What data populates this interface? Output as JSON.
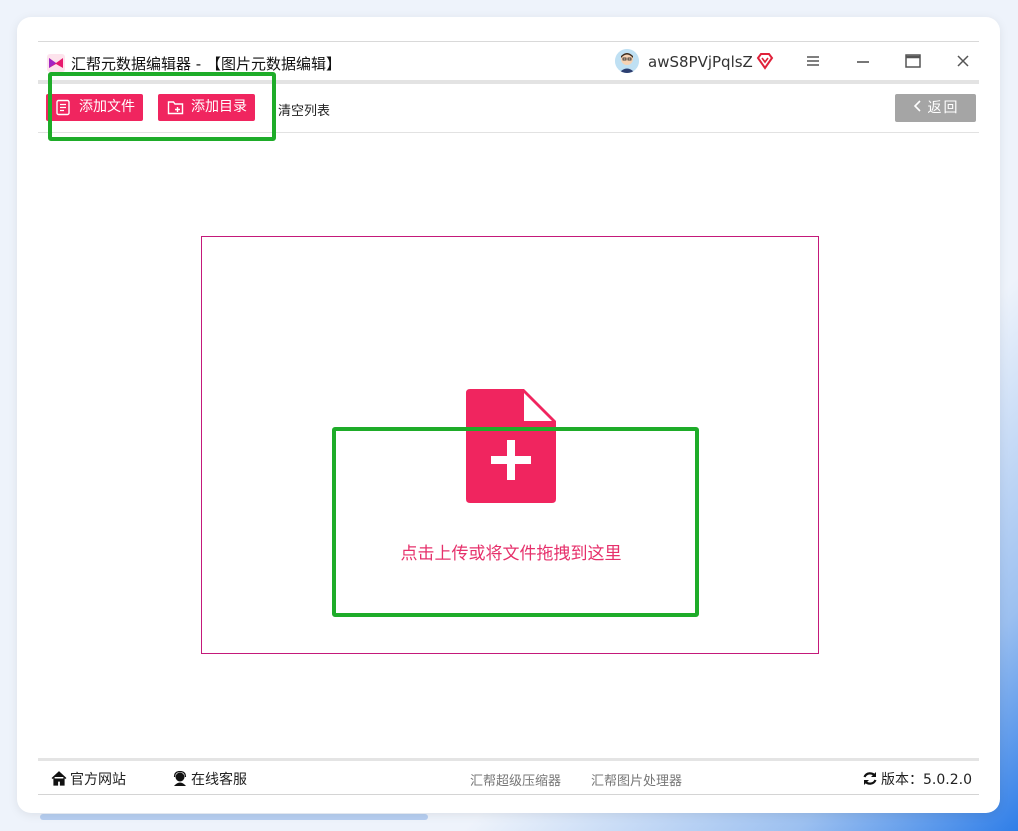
{
  "window": {
    "title": "汇帮元数据编辑器 - 【图片元数据编辑】",
    "username": "awS8PVjPqlsZ"
  },
  "icons": {
    "app": "app-logo-icon",
    "avatar": "user-avatar",
    "vip": "vip-diamond-icon",
    "menu": "hamburger-menu-icon",
    "minimize": "minimize-icon",
    "maximize": "maximize-icon",
    "close": "close-icon",
    "add_file": "add-file-icon",
    "add_dir": "add-folder-icon",
    "back": "chevron-left-icon",
    "upload": "file-plus-icon",
    "home": "home-icon",
    "support": "customer-service-icon",
    "refresh": "refresh-icon"
  },
  "toolbar": {
    "add_file": "添加文件",
    "add_dir": "添加目录",
    "clear": "清空列表",
    "back": "返回"
  },
  "dropzone": {
    "text": "点击上传或将文件拖拽到这里"
  },
  "statusbar": {
    "website": "官方网站",
    "support": "在线客服",
    "compressor": "汇帮超级压缩器",
    "image_processor": "汇帮图片处理器",
    "version": "版本：5.0.2.0"
  },
  "colors": {
    "accent": "#f0255f",
    "dropzone_border": "#c4197a",
    "highlight": "#1eac29",
    "back_button": "#a5a5a5"
  }
}
